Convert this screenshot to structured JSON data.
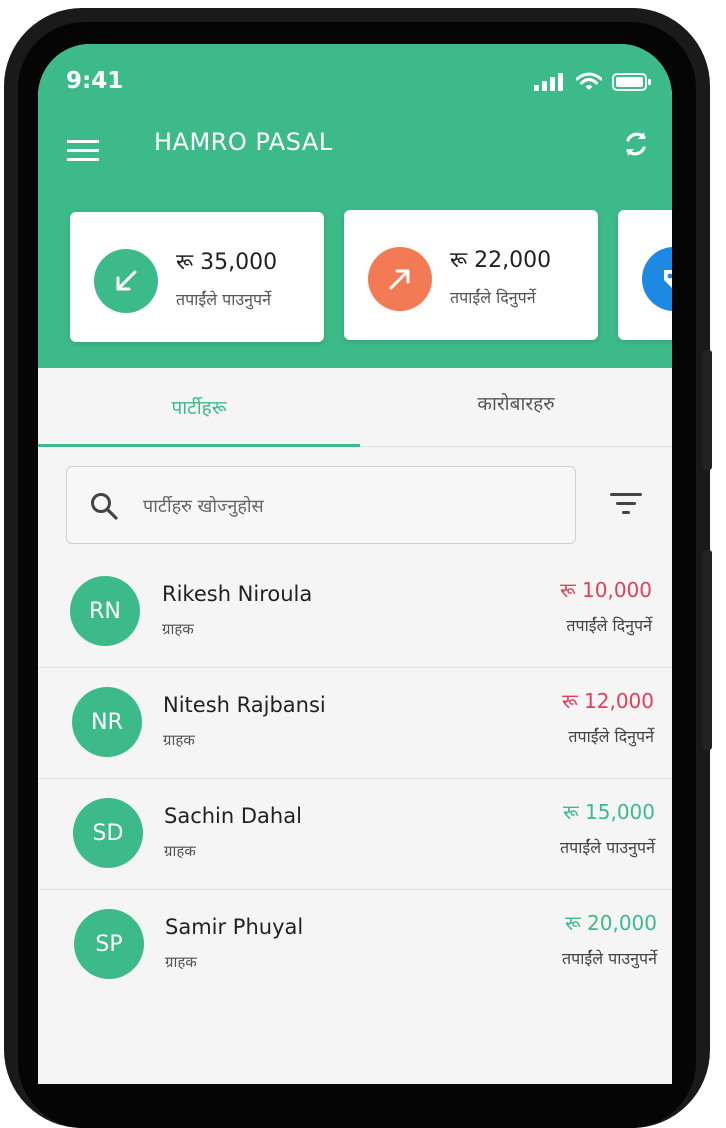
{
  "status_bar": {
    "time": "9:41"
  },
  "app": {
    "title": "HAMRO PASAL"
  },
  "summary_cards": [
    {
      "amount": "रू 35,000",
      "label": "तपाईंले पाउनुपर्ने",
      "color": "#3dba8a",
      "icon": "arrow-down-left-icon"
    },
    {
      "amount": "रू 22,000",
      "label": "तपाईंले दिनुपर्ने",
      "color": "#f27a55",
      "icon": "arrow-up-right-icon"
    },
    {
      "color": "#1e88e5",
      "icon": "tag-icon"
    }
  ],
  "tabs": [
    {
      "label": "पार्टीहरू",
      "active": true
    },
    {
      "label": "कारोबारहरु",
      "active": false
    }
  ],
  "search": {
    "placeholder": "पार्टीहरु खोज्नुहोस"
  },
  "parties": [
    {
      "initials": "RN",
      "name": "Rikesh Niroula",
      "type": "ग्राहक",
      "amount": "रू 10,000",
      "direction": "तपाईंले दिनुपर्ने",
      "amount_color": "#e0405a"
    },
    {
      "initials": "NR",
      "name": "Nitesh Rajbansi",
      "type": "ग्राहक",
      "amount": "रू 12,000",
      "direction": "तपाईंले दिनुपर्ने",
      "amount_color": "#e0405a"
    },
    {
      "initials": "SD",
      "name": "Sachin Dahal",
      "type": "ग्राहक",
      "amount": "रू 15,000",
      "direction": "तपाईंले पाउनुपर्ने",
      "amount_color": "#3dba8a"
    },
    {
      "initials": "SP",
      "name": "Samir Phuyal",
      "type": "ग्राहक",
      "amount": "रू 20,000",
      "direction": "तपाईंले पाउनुपर्ने",
      "amount_color": "#3dba8a"
    }
  ],
  "colors": {
    "primary": "#3dba8a",
    "payable_red": "#e0405a",
    "orange": "#f27a55",
    "blue": "#1e88e5"
  }
}
